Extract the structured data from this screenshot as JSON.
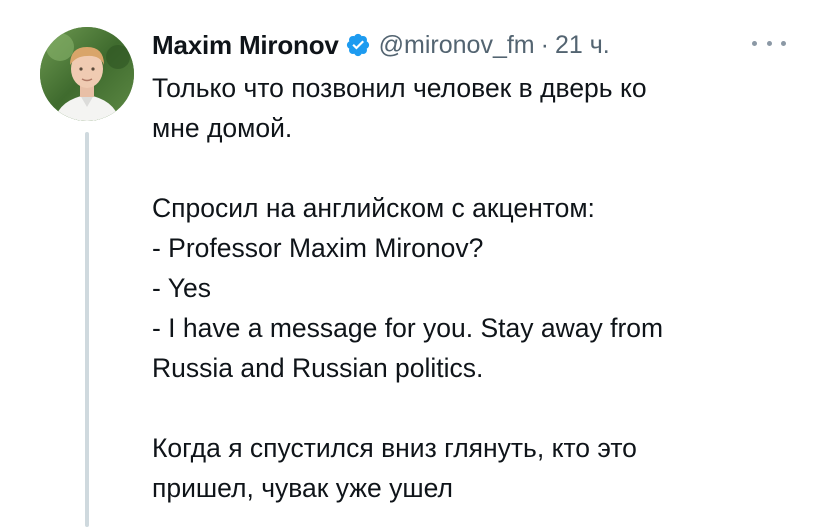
{
  "tweet": {
    "author": {
      "display_name": "Maxim Mironov",
      "verified_icon": "verified-badge-icon",
      "handle": "@mironov_fm",
      "separator": "·",
      "time": "21 ч.",
      "avatar": "avatar"
    },
    "more_icon": "more-horizontal-icon",
    "text": {
      "p1": {
        "l1": "Только что позвонил человек в дверь ко",
        "l2": "мне домой."
      },
      "p2": {
        "l1": "Спросил на английском с акцентом:",
        "l2": "- Professor Maxim Mironov?",
        "l3": "- Yes",
        "l4": "- I have a message for you. Stay away from",
        "l5": "Russia and Russian politics."
      },
      "p3": {
        "l1": "Когда я спустился вниз глянуть, кто это",
        "l2": "пришел, чувак уже ушел"
      }
    }
  },
  "colors": {
    "text": "#0f1419",
    "muted": "#536471",
    "verified_blue": "#1d9bf0",
    "thread_line": "#cfd9de"
  }
}
